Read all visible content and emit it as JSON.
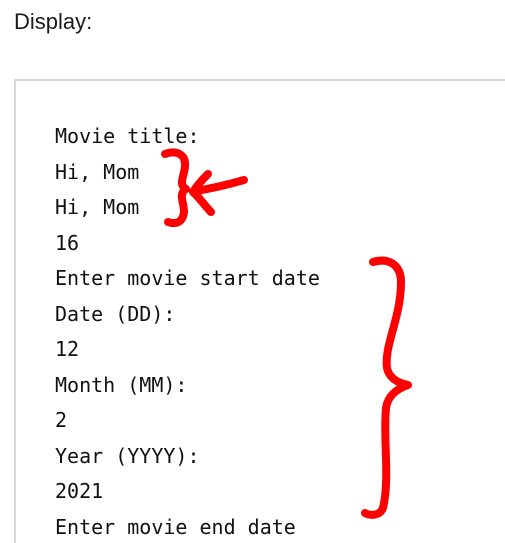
{
  "heading": "Display:",
  "console": {
    "lines": [
      "Movie title:",
      "Hi, Mom",
      "Hi, Mom",
      "16",
      "Enter movie start date",
      "Date (DD):",
      "12",
      "Month (MM):",
      "2",
      "Year (YYYY):",
      "2021",
      "Enter movie end date"
    ]
  },
  "colors": {
    "annotation": "#ff0000",
    "box_border": "#d9d9d9",
    "text": "#111111"
  }
}
